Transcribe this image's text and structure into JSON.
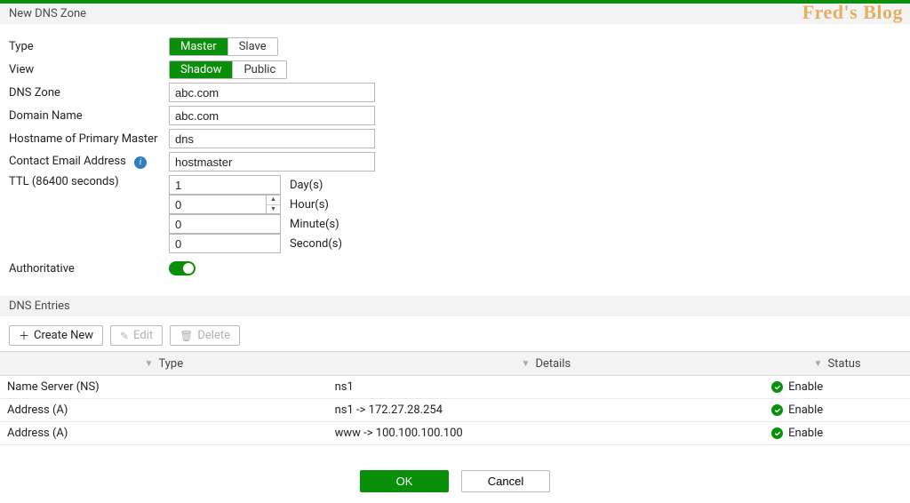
{
  "watermark": "Fred's Blog",
  "header": {
    "title": "New DNS Zone"
  },
  "form": {
    "type": {
      "label": "Type",
      "options": [
        "Master",
        "Slave"
      ],
      "selected": "Master"
    },
    "view": {
      "label": "View",
      "options": [
        "Shadow",
        "Public"
      ],
      "selected": "Shadow"
    },
    "dns_zone": {
      "label": "DNS Zone",
      "value": "abc.com"
    },
    "domain_name": {
      "label": "Domain Name",
      "value": "abc.com"
    },
    "primary_master": {
      "label": "Hostname of Primary Master",
      "value": "dns"
    },
    "contact_email": {
      "label": "Contact Email Address",
      "value": "hostmaster"
    },
    "ttl": {
      "label": "TTL (86400 seconds)",
      "days": {
        "value": "1",
        "unit": "Day(s)"
      },
      "hours": {
        "value": "0",
        "unit": "Hour(s)"
      },
      "minutes": {
        "value": "0",
        "unit": "Minute(s)"
      },
      "seconds": {
        "value": "0",
        "unit": "Second(s)"
      }
    },
    "authoritative": {
      "label": "Authoritative",
      "enabled": true
    }
  },
  "entries_section": {
    "title": "DNS Entries"
  },
  "toolbar": {
    "create_label": "Create New",
    "edit_label": "Edit",
    "delete_label": "Delete"
  },
  "table": {
    "columns": {
      "type": "Type",
      "details": "Details",
      "status": "Status"
    },
    "rows": [
      {
        "type": "Name Server (NS)",
        "details": "ns1",
        "status": "Enable"
      },
      {
        "type": "Address (A)",
        "details": "ns1 -> 172.27.28.254",
        "status": "Enable"
      },
      {
        "type": "Address (A)",
        "details": "www -> 100.100.100.100",
        "status": "Enable"
      }
    ]
  },
  "footer": {
    "ok": "OK",
    "cancel": "Cancel"
  },
  "colors": {
    "primary": "#0a8f0a",
    "accent": "#2f7fc1"
  }
}
